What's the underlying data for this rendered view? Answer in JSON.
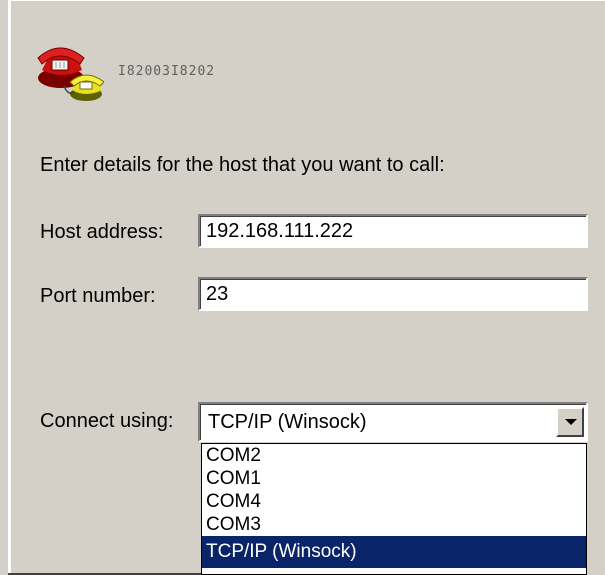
{
  "connection": {
    "name": "I82003I8202",
    "icon": "phone-connection-icon"
  },
  "form": {
    "instruction": "Enter details for the host that you want to call:",
    "host_address": {
      "label": "Host address:",
      "value": "192.168.111.222"
    },
    "port_number": {
      "label": "Port number:",
      "value": "23"
    },
    "connect_using": {
      "label": "Connect using:",
      "selected": "TCP/IP (Winsock)",
      "options": [
        "COM2",
        "COM1",
        "COM4",
        "COM3",
        "TCP/IP (Winsock)"
      ],
      "highlighted_index": 4
    }
  },
  "colors": {
    "dialog_bg": "#d4d0c8",
    "selection_bg": "#0a246a",
    "selection_fg": "#ffffff"
  }
}
